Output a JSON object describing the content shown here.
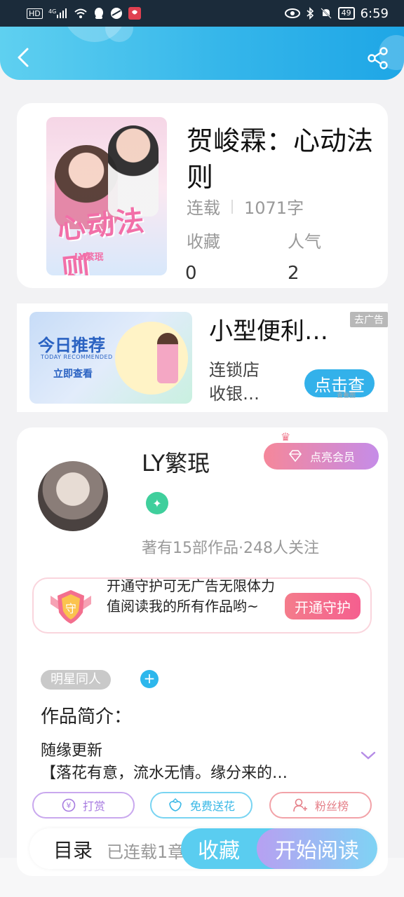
{
  "statusbar": {
    "left_icons": [
      "HD",
      "4G signal",
      "wifi",
      "qq",
      "browser",
      "app"
    ],
    "battery": "49",
    "time": "6:59"
  },
  "header": {
    "back_icon": "back-arrow-icon",
    "share_icon": "share-icon"
  },
  "book": {
    "title": "贺峻霖：心动法则",
    "status": "连载",
    "word_count": "1071字",
    "favorites_label": "收藏",
    "favorites_value": "0",
    "popularity_label": "人气",
    "popularity_value": "2",
    "cover_title": "心动法则",
    "cover_sign": "LY繁珉"
  },
  "ad": {
    "image_title": "今日推荐",
    "image_subtitle": "TODAY RECOMMENDED",
    "image_button": "立即查看",
    "title": "小型便利…",
    "close_label": "去广告",
    "description_line1": "连锁店",
    "description_line2": "收银…",
    "button_label": "点击查",
    "tiny_text": "查看图"
  },
  "author": {
    "name": "LY繁珉",
    "vip_button": "点亮会员",
    "meta": "著有15部作品·248人关注",
    "guard_text": "开通守护可无广告无限体力值阅读我的所有作品哟~",
    "guard_button": "开通守护",
    "guard_shield_char": "守"
  },
  "tags": [
    "明星同人"
  ],
  "intro": {
    "title": "作品简介：",
    "line1": "随缘更新",
    "line2": "【落花有意，流水无情。缘分来的…"
  },
  "actions": {
    "reward": "打赏",
    "flower": "免费送花",
    "fans": "粉丝榜"
  },
  "bottom": {
    "catalog": "目录",
    "status": "已连载1章",
    "collect": "收藏",
    "read": "开始阅读"
  },
  "colors": {
    "header": "#35b6ea",
    "accent": "#2db7ec",
    "vip": "#f5879a",
    "guard": "#f55f8f"
  }
}
